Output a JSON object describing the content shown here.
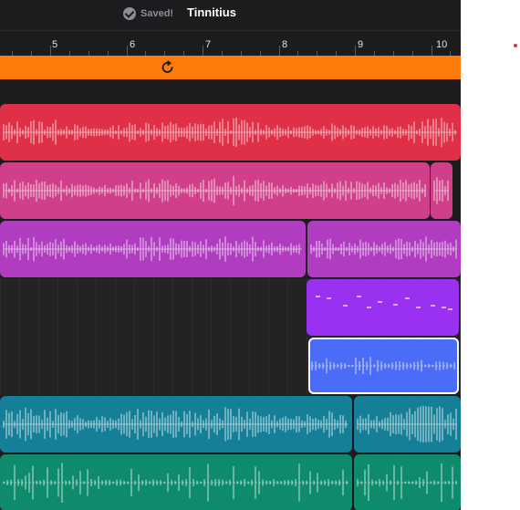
{
  "header": {
    "saved_label": "Saved!",
    "project_title": "Tinnitius"
  },
  "ruler": {
    "bars": [
      "5",
      "6",
      "7",
      "8",
      "9",
      "10"
    ]
  },
  "icons": {
    "saved": "checkmark-circle-icon",
    "loop": "loop-cycle-icon"
  },
  "colors": {
    "background": "#1c1c1e",
    "cycle_region": "#ff7c0a",
    "track_1": "#e03048",
    "track_2": "#d0408a",
    "track_3": "#b03cc0",
    "track_4": "#9a30f0",
    "track_5": "#4a6cf6",
    "track_6": "#147f96",
    "track_7": "#0e8a6c",
    "side_marker": "#e0303e"
  },
  "tracks": [
    {
      "name": "track-1",
      "type": "audio"
    },
    {
      "name": "track-2",
      "type": "audio"
    },
    {
      "name": "track-3",
      "type": "audio"
    },
    {
      "name": "track-4",
      "type": "midi"
    },
    {
      "name": "track-5",
      "type": "audio",
      "selected": true
    },
    {
      "name": "track-6",
      "type": "audio"
    },
    {
      "name": "track-7",
      "type": "audio"
    }
  ]
}
